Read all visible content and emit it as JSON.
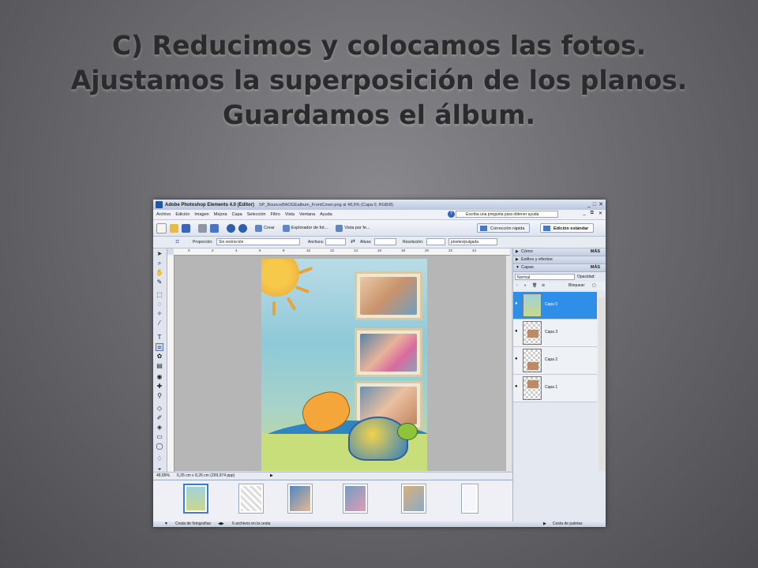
{
  "slide": {
    "title_lines": [
      "C) Reducimos y colocamos las fotos.",
      "Ajustamos la superposición de los planos.",
      "Guardamos el álbum."
    ]
  },
  "window": {
    "app_title": "Adobe Photoshop Elements 4.0 (Editor)",
    "file_title": "SP_BounceBAOGEalbum_FrontCover.png al 48,9% (Capa 0, RGB/8)",
    "controls": [
      "_",
      "□",
      "✕"
    ]
  },
  "menu": {
    "items": [
      "Archivo",
      "Edición",
      "Imagen",
      "Mejora",
      "Capa",
      "Selección",
      "Filtro",
      "Vista",
      "Ventana",
      "Ayuda"
    ],
    "help_placeholder": "Escriba una pregunta para obtener ayuda",
    "help_icon": "question-icon",
    "doc_controls": [
      "_",
      "⧉",
      "✕"
    ]
  },
  "shortcuts": {
    "crear": "Crear",
    "explorador": "Explorador de fot...",
    "vista": "Vista por fe...",
    "correccion": "Corrección rápida",
    "edicion": "Edición estándar"
  },
  "options": {
    "proporcion_label": "Proporción:",
    "proporcion_value": "Sin restricción",
    "anchura_label": "Anchura:",
    "altura_label": "Altura:",
    "resolucion_label": "Resolución:",
    "unidad_value": "píxeles/pulgada"
  },
  "ruler": {
    "ticks": [
      "0",
      "2",
      "4",
      "6",
      "8",
      "10",
      "12",
      "14",
      "16",
      "18",
      "20",
      "22",
      "24"
    ]
  },
  "status": {
    "zoom": "48,89%",
    "doc_size": "6,35 cm x 8,26 cm (299,974 ppp)"
  },
  "panels": {
    "como": "Cómo",
    "estilos": "Estilos y efectos",
    "capas": "Capas",
    "mas": "MÁS",
    "blend_mode": "Normal",
    "opacidad": "Opacidad:",
    "bloquear": "Bloquear:",
    "layers": [
      {
        "name": "Capa 0",
        "selected": true
      },
      {
        "name": "Capa 3",
        "selected": false
      },
      {
        "name": "Capa 2",
        "selected": false
      },
      {
        "name": "Capa 1",
        "selected": false
      }
    ]
  },
  "bin": {
    "label": "Cesta de fotografías",
    "count": "6 archivos en la cesta",
    "palettes": "Cesta de paletas"
  }
}
